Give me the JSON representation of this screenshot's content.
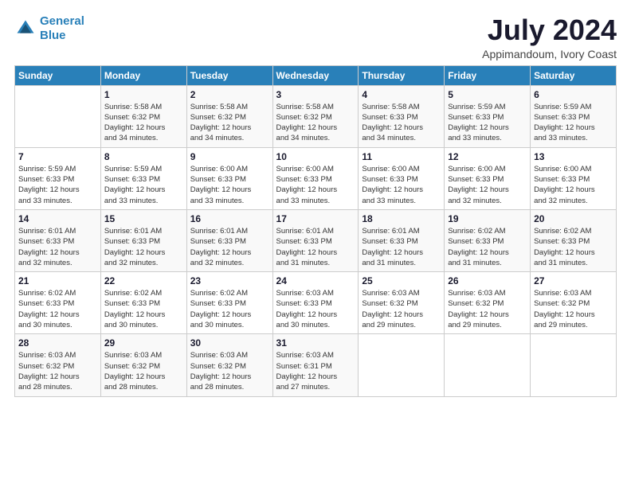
{
  "logo": {
    "line1": "General",
    "line2": "Blue"
  },
  "title": "July 2024",
  "subtitle": "Appimandoum, Ivory Coast",
  "weekdays": [
    "Sunday",
    "Monday",
    "Tuesday",
    "Wednesday",
    "Thursday",
    "Friday",
    "Saturday"
  ],
  "weeks": [
    [
      {
        "day": "",
        "info": ""
      },
      {
        "day": "1",
        "info": "Sunrise: 5:58 AM\nSunset: 6:32 PM\nDaylight: 12 hours\nand 34 minutes."
      },
      {
        "day": "2",
        "info": "Sunrise: 5:58 AM\nSunset: 6:32 PM\nDaylight: 12 hours\nand 34 minutes."
      },
      {
        "day": "3",
        "info": "Sunrise: 5:58 AM\nSunset: 6:32 PM\nDaylight: 12 hours\nand 34 minutes."
      },
      {
        "day": "4",
        "info": "Sunrise: 5:58 AM\nSunset: 6:33 PM\nDaylight: 12 hours\nand 34 minutes."
      },
      {
        "day": "5",
        "info": "Sunrise: 5:59 AM\nSunset: 6:33 PM\nDaylight: 12 hours\nand 33 minutes."
      },
      {
        "day": "6",
        "info": "Sunrise: 5:59 AM\nSunset: 6:33 PM\nDaylight: 12 hours\nand 33 minutes."
      }
    ],
    [
      {
        "day": "7",
        "info": "Sunrise: 5:59 AM\nSunset: 6:33 PM\nDaylight: 12 hours\nand 33 minutes."
      },
      {
        "day": "8",
        "info": "Sunrise: 5:59 AM\nSunset: 6:33 PM\nDaylight: 12 hours\nand 33 minutes."
      },
      {
        "day": "9",
        "info": "Sunrise: 6:00 AM\nSunset: 6:33 PM\nDaylight: 12 hours\nand 33 minutes."
      },
      {
        "day": "10",
        "info": "Sunrise: 6:00 AM\nSunset: 6:33 PM\nDaylight: 12 hours\nand 33 minutes."
      },
      {
        "day": "11",
        "info": "Sunrise: 6:00 AM\nSunset: 6:33 PM\nDaylight: 12 hours\nand 33 minutes."
      },
      {
        "day": "12",
        "info": "Sunrise: 6:00 AM\nSunset: 6:33 PM\nDaylight: 12 hours\nand 32 minutes."
      },
      {
        "day": "13",
        "info": "Sunrise: 6:00 AM\nSunset: 6:33 PM\nDaylight: 12 hours\nand 32 minutes."
      }
    ],
    [
      {
        "day": "14",
        "info": "Sunrise: 6:01 AM\nSunset: 6:33 PM\nDaylight: 12 hours\nand 32 minutes."
      },
      {
        "day": "15",
        "info": "Sunrise: 6:01 AM\nSunset: 6:33 PM\nDaylight: 12 hours\nand 32 minutes."
      },
      {
        "day": "16",
        "info": "Sunrise: 6:01 AM\nSunset: 6:33 PM\nDaylight: 12 hours\nand 32 minutes."
      },
      {
        "day": "17",
        "info": "Sunrise: 6:01 AM\nSunset: 6:33 PM\nDaylight: 12 hours\nand 31 minutes."
      },
      {
        "day": "18",
        "info": "Sunrise: 6:01 AM\nSunset: 6:33 PM\nDaylight: 12 hours\nand 31 minutes."
      },
      {
        "day": "19",
        "info": "Sunrise: 6:02 AM\nSunset: 6:33 PM\nDaylight: 12 hours\nand 31 minutes."
      },
      {
        "day": "20",
        "info": "Sunrise: 6:02 AM\nSunset: 6:33 PM\nDaylight: 12 hours\nand 31 minutes."
      }
    ],
    [
      {
        "day": "21",
        "info": "Sunrise: 6:02 AM\nSunset: 6:33 PM\nDaylight: 12 hours\nand 30 minutes."
      },
      {
        "day": "22",
        "info": "Sunrise: 6:02 AM\nSunset: 6:33 PM\nDaylight: 12 hours\nand 30 minutes."
      },
      {
        "day": "23",
        "info": "Sunrise: 6:02 AM\nSunset: 6:33 PM\nDaylight: 12 hours\nand 30 minutes."
      },
      {
        "day": "24",
        "info": "Sunrise: 6:03 AM\nSunset: 6:33 PM\nDaylight: 12 hours\nand 30 minutes."
      },
      {
        "day": "25",
        "info": "Sunrise: 6:03 AM\nSunset: 6:32 PM\nDaylight: 12 hours\nand 29 minutes."
      },
      {
        "day": "26",
        "info": "Sunrise: 6:03 AM\nSunset: 6:32 PM\nDaylight: 12 hours\nand 29 minutes."
      },
      {
        "day": "27",
        "info": "Sunrise: 6:03 AM\nSunset: 6:32 PM\nDaylight: 12 hours\nand 29 minutes."
      }
    ],
    [
      {
        "day": "28",
        "info": "Sunrise: 6:03 AM\nSunset: 6:32 PM\nDaylight: 12 hours\nand 28 minutes."
      },
      {
        "day": "29",
        "info": "Sunrise: 6:03 AM\nSunset: 6:32 PM\nDaylight: 12 hours\nand 28 minutes."
      },
      {
        "day": "30",
        "info": "Sunrise: 6:03 AM\nSunset: 6:32 PM\nDaylight: 12 hours\nand 28 minutes."
      },
      {
        "day": "31",
        "info": "Sunrise: 6:03 AM\nSunset: 6:31 PM\nDaylight: 12 hours\nand 27 minutes."
      },
      {
        "day": "",
        "info": ""
      },
      {
        "day": "",
        "info": ""
      },
      {
        "day": "",
        "info": ""
      }
    ]
  ]
}
